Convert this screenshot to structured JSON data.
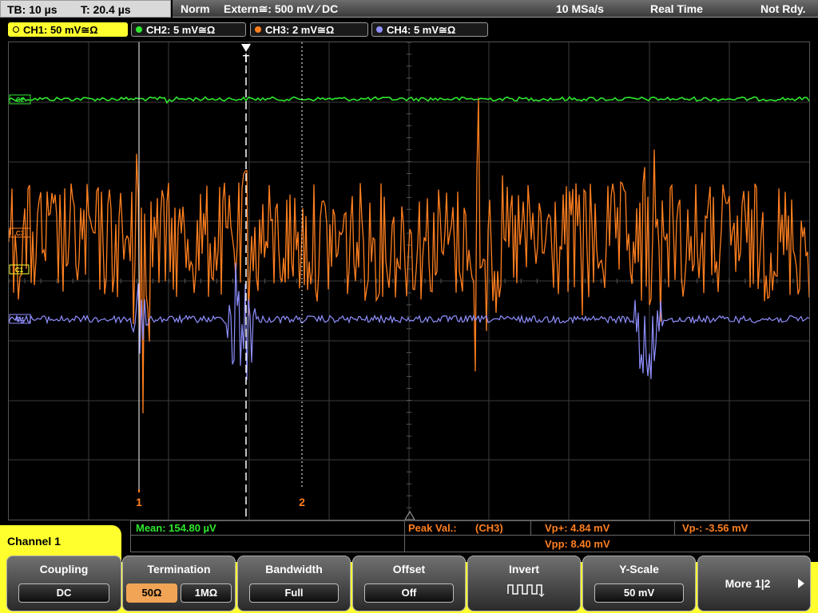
{
  "status": {
    "timebase": "TB: 10 µs",
    "trigger_time": "T: 20.4 µs",
    "mode": "Norm",
    "trigger_source": "Extern≅: 500 mV ⁄ DC",
    "sample_rate": "10 MSa/s",
    "acq_mode": "Real Time",
    "state": "Not Rdy."
  },
  "channels": [
    {
      "label": "CH1: 50 mV≅Ω",
      "color": "#ffff2e",
      "active": true
    },
    {
      "label": "CH2: 5 mV≅Ω",
      "color": "#2ee82e",
      "active": false
    },
    {
      "label": "CH3: 2 mV≅Ω",
      "color": "#ff7f1f",
      "active": false
    },
    {
      "label": "CH4: 5 mV≅Ω",
      "color": "#8f8fff",
      "active": false
    }
  ],
  "markers": {
    "ch2": "C2",
    "ch3": "C3",
    "ch1": "C1",
    "ch4": "C4",
    "trigger": "T",
    "cursor1": "1",
    "cursor2": "2"
  },
  "measurements": {
    "mean": "Mean: 154.80 µV",
    "peak_label": "Peak Val.:",
    "peak_channel": "(CH3)",
    "vp_plus": "Vp+: 4.84 mV",
    "vpp": "Vpp: 8.40 mV",
    "vp_minus": "Vp-: -3.56 mV"
  },
  "panel": {
    "title": "Channel 1",
    "coupling": {
      "label": "Coupling",
      "value": "DC"
    },
    "termination": {
      "label": "Termination",
      "opt_50": "50Ω",
      "opt_1m": "1MΩ",
      "selected": "50Ω"
    },
    "bandwidth": {
      "label": "Bandwidth",
      "value": "Full"
    },
    "offset": {
      "label": "Offset",
      "value": "Off"
    },
    "invert": {
      "label": "Invert",
      "icon": "inverted-pulse-icon"
    },
    "yscale": {
      "label": "Y-Scale",
      "value": "50 mV"
    },
    "more": {
      "label": "More 1|2",
      "icon": "arrow-right-icon"
    }
  },
  "colors": {
    "ch1": "#ffff2e",
    "ch2": "#2ee82e",
    "ch3": "#ff7f1f",
    "ch4": "#8f8fff",
    "cursor": "#ff7f1f"
  }
}
